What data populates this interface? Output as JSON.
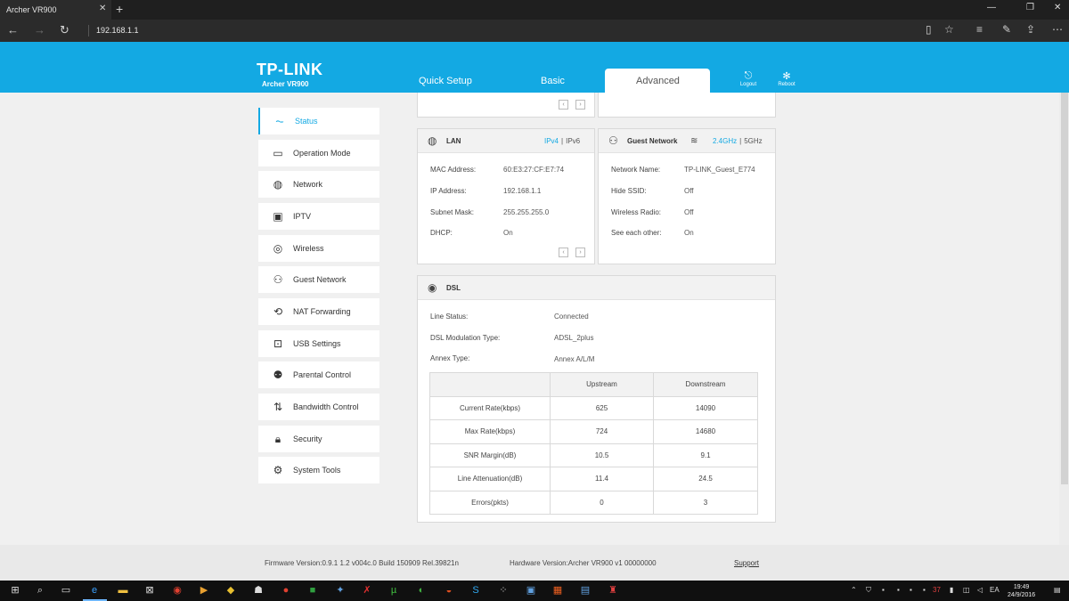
{
  "browser": {
    "tab_title": "Archer VR900",
    "tab_close": "✕",
    "new_tab": "+",
    "window_controls": [
      "—",
      "❐",
      "✕"
    ],
    "url": "192.168.1.1",
    "nav_icons": [
      "back-icon",
      "forward-icon",
      "refresh-icon"
    ],
    "toolbar_icons": [
      "reading-view-icon",
      "favorite-star-icon",
      "hub-icon",
      "web-note-icon",
      "share-icon",
      "more-icon"
    ]
  },
  "router": {
    "brand": "TP-LINK",
    "model": "Archer VR900",
    "nav": [
      {
        "label": "Quick Setup"
      },
      {
        "label": "Basic"
      },
      {
        "label": "Advanced"
      }
    ],
    "logout_label": "Logout",
    "reboot_label": "Reboot"
  },
  "sidebar": {
    "items": [
      {
        "label": "Status",
        "icon": "status-icon"
      },
      {
        "label": "Operation Mode",
        "icon": "monitor-icon"
      },
      {
        "label": "Network",
        "icon": "globe-icon"
      },
      {
        "label": "IPTV",
        "icon": "tv-icon"
      },
      {
        "label": "Wireless",
        "icon": "wireless-icon"
      },
      {
        "label": "Guest Network",
        "icon": "guest-network-icon"
      },
      {
        "label": "NAT Forwarding",
        "icon": "nat-forwarding-icon"
      },
      {
        "label": "USB Settings",
        "icon": "usb-icon"
      },
      {
        "label": "Parental Control",
        "icon": "parental-control-icon"
      },
      {
        "label": "Bandwidth Control",
        "icon": "bandwidth-icon"
      },
      {
        "label": "Security",
        "icon": "lock-icon"
      },
      {
        "label": "System Tools",
        "icon": "gear-icon"
      }
    ]
  },
  "lan": {
    "title": "LAN",
    "ipv4": "IPv4",
    "ipv6": "IPv6",
    "rows": [
      {
        "label": "MAC Address:",
        "value": "60:E3:27:CF:E7:74"
      },
      {
        "label": "IP Address:",
        "value": "192.168.1.1"
      },
      {
        "label": "Subnet Mask:",
        "value": "255.255.255.0"
      },
      {
        "label": "DHCP:",
        "value": "On"
      }
    ]
  },
  "guest": {
    "title": "Guest Network",
    "band_24": "2.4GHz",
    "band_5": "5GHz",
    "rows": [
      {
        "label": "Network Name:",
        "value": "TP-LINK_Guest_E774"
      },
      {
        "label": "Hide SSID:",
        "value": "Off"
      },
      {
        "label": "Wireless Radio:",
        "value": "Off"
      },
      {
        "label": "See each other:",
        "value": "On"
      }
    ]
  },
  "dsl": {
    "title": "DSL",
    "rows": [
      {
        "label": "Line Status:",
        "value": "Connected"
      },
      {
        "label": "DSL Modulation Type:",
        "value": "ADSL_2plus"
      },
      {
        "label": "Annex Type:",
        "value": "Annex A/L/M"
      }
    ],
    "table": {
      "headers": [
        "",
        "Upstream",
        "Downstream"
      ],
      "rows": [
        [
          "Current Rate(kbps)",
          "625",
          "14090"
        ],
        [
          "Max Rate(kbps)",
          "724",
          "14680"
        ],
        [
          "SNR Margin(dB)",
          "10.5",
          "9.1"
        ],
        [
          "Line Attenuation(dB)",
          "11.4",
          "24.5"
        ],
        [
          "Errors(pkts)",
          "0",
          "3"
        ]
      ]
    }
  },
  "footer": {
    "firmware": "Firmware Version:0.9.1 1.2 v004c.0 Build 150909 Rel.39821n",
    "hardware": "Hardware Version:Archer VR900 v1 00000000",
    "support": "Support"
  },
  "taskbar": {
    "lang": "EA",
    "time": "19:49",
    "date": "24/9/2016",
    "badge": "37"
  }
}
